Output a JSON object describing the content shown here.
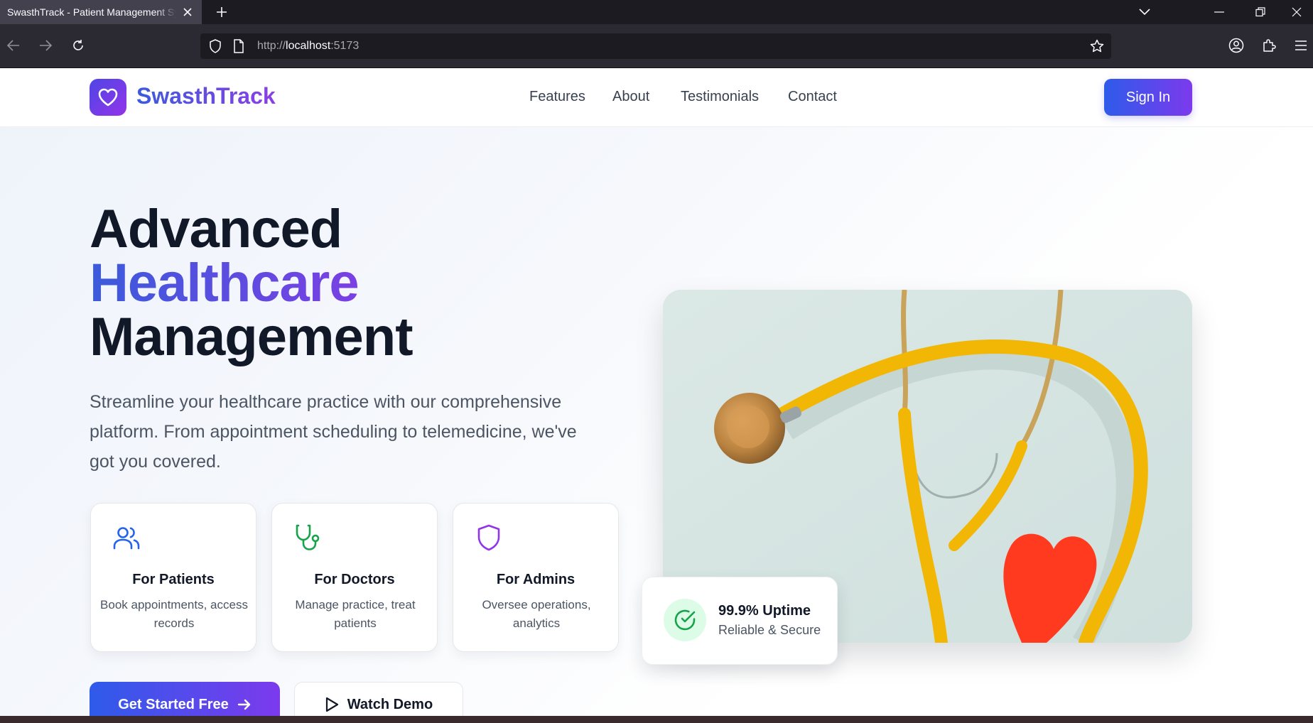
{
  "browser": {
    "tab_title": "SwasthTrack - Patient Management System",
    "url_scheme": "http://",
    "url_host": "localhost",
    "url_port": ":5173"
  },
  "site": {
    "brand": "SwasthTrack",
    "nav": [
      "Features",
      "About",
      "Testimonials",
      "Contact"
    ],
    "sign_in": "Sign In"
  },
  "hero": {
    "line1": "Advanced",
    "line2": "Healthcare",
    "line3": "Management",
    "lead": "Streamline your healthcare practice with our comprehensive platform. From appointment scheduling to telemedicine, we've got you covered.",
    "cards": [
      {
        "icon": "users-icon",
        "title": "For Patients",
        "desc": "Book appointments, access records",
        "color": "#2563eb"
      },
      {
        "icon": "stethoscope-icon",
        "title": "For Doctors",
        "desc": "Manage practice, treat patients",
        "color": "#16a34a"
      },
      {
        "icon": "shield-icon",
        "title": "For Admins",
        "desc": "Oversee operations, analytics",
        "color": "#9333ea"
      }
    ],
    "cta_primary": "Get Started Free",
    "cta_secondary": "Watch Demo",
    "uptime_title": "99.9% Uptime",
    "uptime_sub": "Reliable & Secure"
  },
  "colors": {
    "accent_start": "#2e5bea",
    "accent_end": "#7c3aed",
    "success": "#16a34a"
  }
}
